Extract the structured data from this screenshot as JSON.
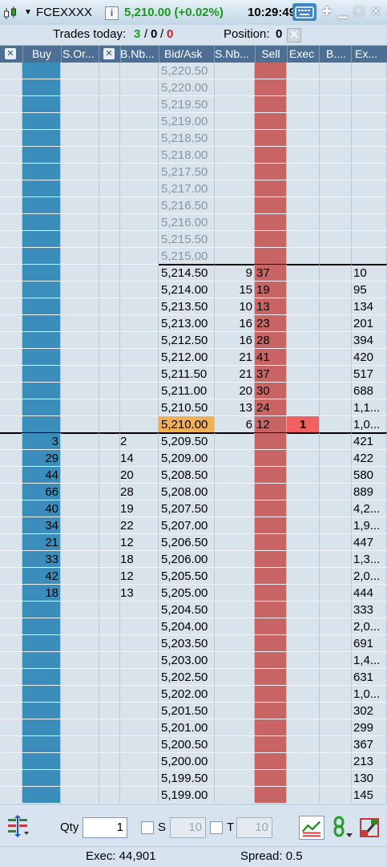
{
  "title_bar": {
    "symbol": "FCEXXXX",
    "info_icon_text": "i",
    "last_price": "5,210.00 (+0.02%)",
    "clock": "10:29:49"
  },
  "info_bar": {
    "trades_label": "Trades today:",
    "trades_v1": "3",
    "trades_v2": "0",
    "trades_v3": "0",
    "position_label": "Position:",
    "position_value": "0"
  },
  "headers": [
    "Buy",
    "S.Or...",
    "B.Nb...",
    "Bid/Ask",
    "S.Nb...",
    "Sell",
    "Exec",
    "B....",
    "Ex..."
  ],
  "ladder": {
    "upper_asks": [
      "5,220.50",
      "5,220.00",
      "5,219.50",
      "5,219.00",
      "5,218.50",
      "5,218.00",
      "5,217.50",
      "5,217.00",
      "5,216.50",
      "5,216.00",
      "5,215.50",
      "5,215.00"
    ],
    "ask_rows": [
      {
        "price": "5,214.50",
        "snb": "9",
        "sell": "37",
        "exec": "",
        "ex": "10"
      },
      {
        "price": "5,214.00",
        "snb": "15",
        "sell": "19",
        "exec": "",
        "ex": "95"
      },
      {
        "price": "5,213.50",
        "snb": "10",
        "sell": "13",
        "exec": "",
        "ex": "134"
      },
      {
        "price": "5,213.00",
        "snb": "16",
        "sell": "23",
        "exec": "",
        "ex": "201"
      },
      {
        "price": "5,212.50",
        "snb": "16",
        "sell": "28",
        "exec": "",
        "ex": "394"
      },
      {
        "price": "5,212.00",
        "snb": "21",
        "sell": "41",
        "exec": "",
        "ex": "420"
      },
      {
        "price": "5,211.50",
        "snb": "21",
        "sell": "37",
        "exec": "",
        "ex": "517"
      },
      {
        "price": "5,211.00",
        "snb": "20",
        "sell": "30",
        "exec": "",
        "ex": "688"
      },
      {
        "price": "5,210.50",
        "snb": "13",
        "sell": "24",
        "exec": "",
        "ex": "1,1..."
      },
      {
        "price": "5,210.00",
        "snb": "6",
        "sell": "12",
        "exec": "1",
        "ex": "1,0..."
      }
    ],
    "bid_rows": [
      {
        "buy": "3",
        "bnb": "2",
        "price": "5,209.50",
        "ex": "421"
      },
      {
        "buy": "29",
        "bnb": "14",
        "price": "5,209.00",
        "ex": "422"
      },
      {
        "buy": "44",
        "bnb": "20",
        "price": "5,208.50",
        "ex": "580"
      },
      {
        "buy": "66",
        "bnb": "28",
        "price": "5,208.00",
        "ex": "889"
      },
      {
        "buy": "40",
        "bnb": "19",
        "price": "5,207.50",
        "ex": "4,2..."
      },
      {
        "buy": "34",
        "bnb": "22",
        "price": "5,207.00",
        "ex": "1,9..."
      },
      {
        "buy": "21",
        "bnb": "12",
        "price": "5,206.50",
        "ex": "447"
      },
      {
        "buy": "33",
        "bnb": "18",
        "price": "5,206.00",
        "ex": "1,3..."
      },
      {
        "buy": "42",
        "bnb": "12",
        "price": "5,205.50",
        "ex": "2,0..."
      },
      {
        "buy": "18",
        "bnb": "13",
        "price": "5,205.00",
        "ex": "444"
      }
    ],
    "lower_rows": [
      {
        "price": "5,204.50",
        "ex": "333"
      },
      {
        "price": "5,204.00",
        "ex": "2,0..."
      },
      {
        "price": "5,203.50",
        "ex": "691"
      },
      {
        "price": "5,203.00",
        "ex": "1,4..."
      },
      {
        "price": "5,202.50",
        "ex": "631"
      },
      {
        "price": "5,202.00",
        "ex": "1,0..."
      },
      {
        "price": "5,201.50",
        "ex": "302"
      },
      {
        "price": "5,201.00",
        "ex": "299"
      },
      {
        "price": "5,200.50",
        "ex": "367"
      },
      {
        "price": "5,200.00",
        "ex": "213"
      },
      {
        "price": "5,199.50",
        "ex": "130"
      },
      {
        "price": "5,199.00",
        "ex": "145"
      }
    ]
  },
  "bottom_bar": {
    "qty_label": "Qty",
    "qty_value": "1",
    "s_label": "S",
    "s_value": "10",
    "t_label": "T",
    "t_value": "10"
  },
  "status_bar": {
    "exec": "Exec: 44,901",
    "spread": "Spread: 0.5"
  },
  "colors": {
    "buy_column": "#3b8dbb",
    "sell_column": "#c86464",
    "current_price": "#f0b057",
    "exec_highlight": "#f06060",
    "header_bg": "#4d6f93",
    "price_up": "#1a9a1a"
  },
  "icons": [
    "chart-icon",
    "dropdown-icon",
    "info-icon",
    "keyboard-icon",
    "pin-icon",
    "minimize-icon",
    "maximize-icon",
    "close-icon",
    "position-close-icon",
    "column-close-icon",
    "ladder-icon",
    "graph-icon",
    "link-icon",
    "tools-icon"
  ]
}
